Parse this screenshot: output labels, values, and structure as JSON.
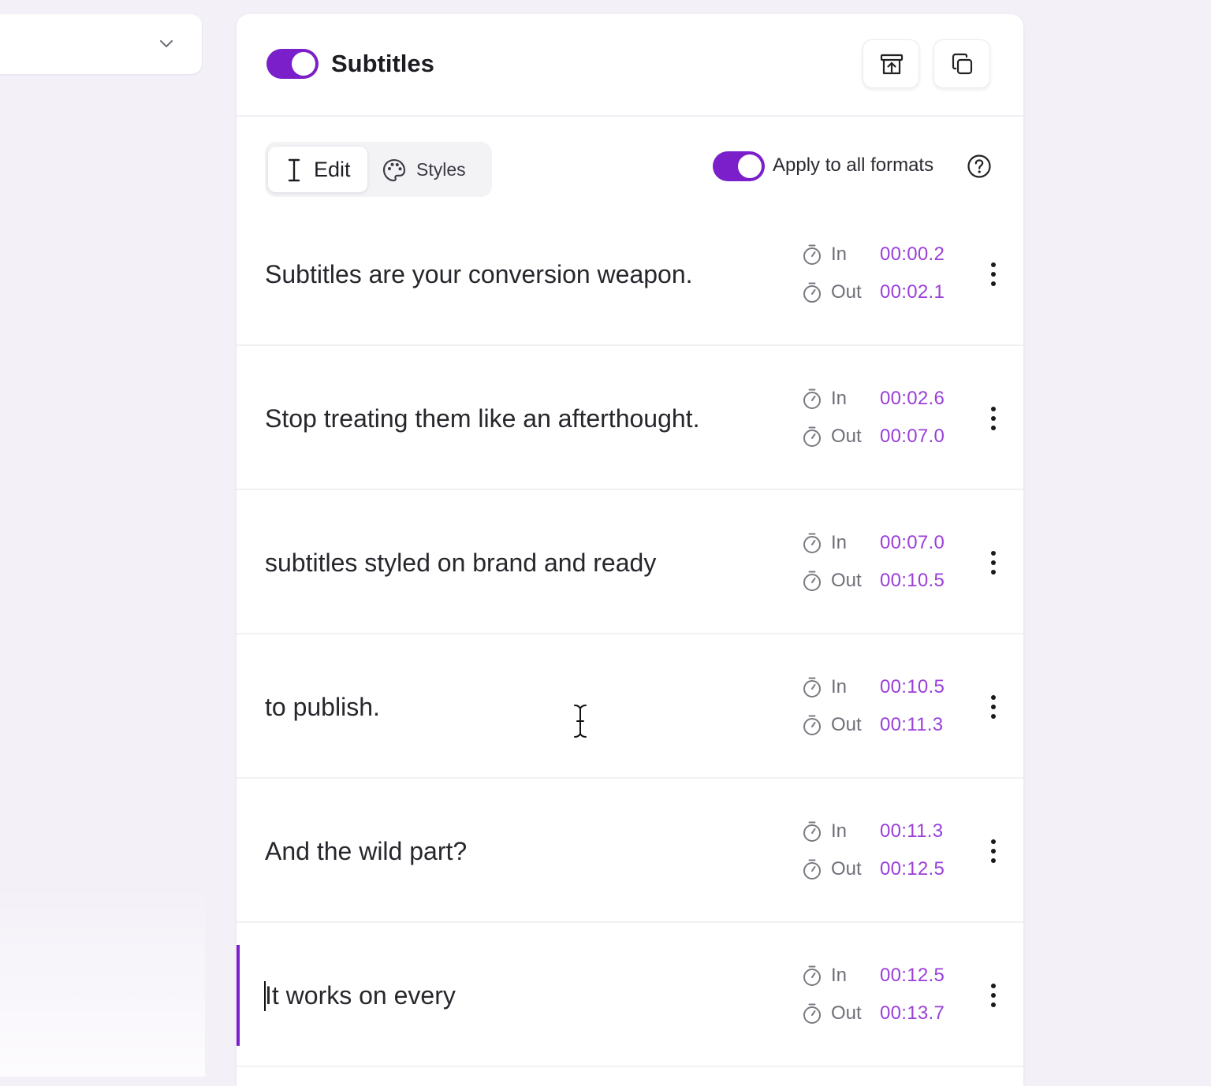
{
  "left_panel": {
    "dropdown_icon": "chevron-down-icon"
  },
  "header": {
    "toggle_on": true,
    "title": "Subtitles",
    "actions": [
      {
        "icon": "archive-upload-icon"
      },
      {
        "icon": "copy-icon"
      }
    ]
  },
  "tabs": [
    {
      "label": "Edit",
      "icon": "text-cursor-icon",
      "active": true
    },
    {
      "label": "Styles",
      "icon": "palette-icon",
      "active": false
    }
  ],
  "apply_all": {
    "label": "Apply to all formats",
    "enabled": true,
    "help_icon": "question-circle-icon"
  },
  "time_labels": {
    "in": "In",
    "out": "Out"
  },
  "subtitles": [
    {
      "text": "Subtitles are your conversion weapon.",
      "in": "00:00.2",
      "out": "00:02.1"
    },
    {
      "text": "Stop treating them like an afterthought.",
      "in": "00:02.6",
      "out": "00:07.0"
    },
    {
      "text": "subtitles styled on brand and ready",
      "in": "00:07.0",
      "out": "00:10.5"
    },
    {
      "text": "to publish.",
      "in": "00:10.5",
      "out": "00:11.3"
    },
    {
      "text": "And the wild part?",
      "in": "00:11.3",
      "out": "00:12.5"
    },
    {
      "text": "It works on every",
      "in": "00:12.5",
      "out": "00:13.7",
      "active": true
    }
  ],
  "colors": {
    "accent": "#7a1fc9",
    "timecode": "#9a3fd8",
    "background": "#f4f0f8"
  }
}
